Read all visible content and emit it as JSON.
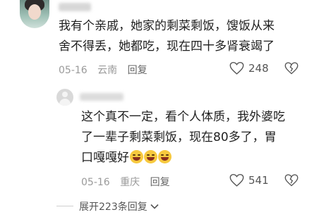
{
  "comment": {
    "lines": [
      "我有个亲戚，她家的剩菜剩饭，馊饭从来",
      "舍不得丢，她都吃，现在四十多肾衰竭了"
    ],
    "date": "05-16",
    "location": "云南",
    "reply_label": "回复",
    "like_count": "248",
    "icons": {
      "like": "heart-icon",
      "dislike": "broken-heart-icon"
    }
  },
  "reply": {
    "lines": [
      "这个真不一定，看个人体质，我外婆吃",
      "了一辈子剩菜剩饭，现在80多了，胃",
      "口嘎嘎好"
    ],
    "emojis": [
      "laugh-cry-emoji",
      "laugh-cry-emoji",
      "laugh-cry-emoji"
    ],
    "date": "05-16",
    "location": "重庆",
    "reply_label": "回复",
    "like_count": "541"
  },
  "expand_replies": {
    "label": "展开223条回复",
    "icon": "chevron-down-icon"
  }
}
